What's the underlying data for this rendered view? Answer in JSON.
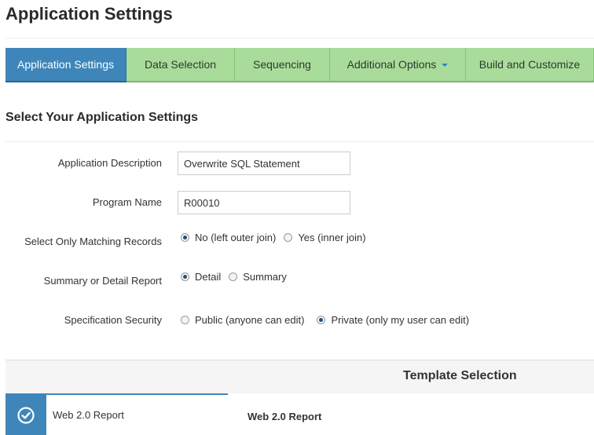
{
  "page": {
    "title": "Application Settings"
  },
  "tabs": [
    {
      "label": "Application Settings",
      "active": true
    },
    {
      "label": "Data Selection",
      "active": false
    },
    {
      "label": "Sequencing",
      "active": false
    },
    {
      "label": "Additional Options",
      "active": false,
      "has_dropdown": true
    },
    {
      "label": "Build and Customize",
      "active": false
    }
  ],
  "section": {
    "title": "Select Your Application Settings"
  },
  "form": {
    "app_description": {
      "label": "Application Description",
      "value": "Overwrite SQL Statement"
    },
    "program_name": {
      "label": "Program Name",
      "value": "R00010"
    },
    "matching_records": {
      "label": "Select Only Matching Records",
      "options": [
        {
          "label": "No (left outer join)",
          "selected": true
        },
        {
          "label": "Yes (inner join)",
          "selected": false
        }
      ]
    },
    "report_type": {
      "label": "Summary or Detail Report",
      "options": [
        {
          "label": "Detail",
          "selected": true
        },
        {
          "label": "Summary",
          "selected": false
        }
      ]
    },
    "spec_security": {
      "label": "Specification Security",
      "options": [
        {
          "label": "Public (anyone can edit)",
          "selected": false
        },
        {
          "label": "Private (only my user can edit)",
          "selected": true
        }
      ]
    }
  },
  "templates": {
    "header": "Template Selection",
    "items": [
      {
        "label": "Web 2.0 Report",
        "selected": true,
        "icon": "check-circle-icon"
      }
    ],
    "detail_title": "Web 2.0 Report"
  },
  "colors": {
    "active_tab": "#3e86ba",
    "inactive_tab": "#a9dc9b",
    "accent": "#2a83c6"
  }
}
